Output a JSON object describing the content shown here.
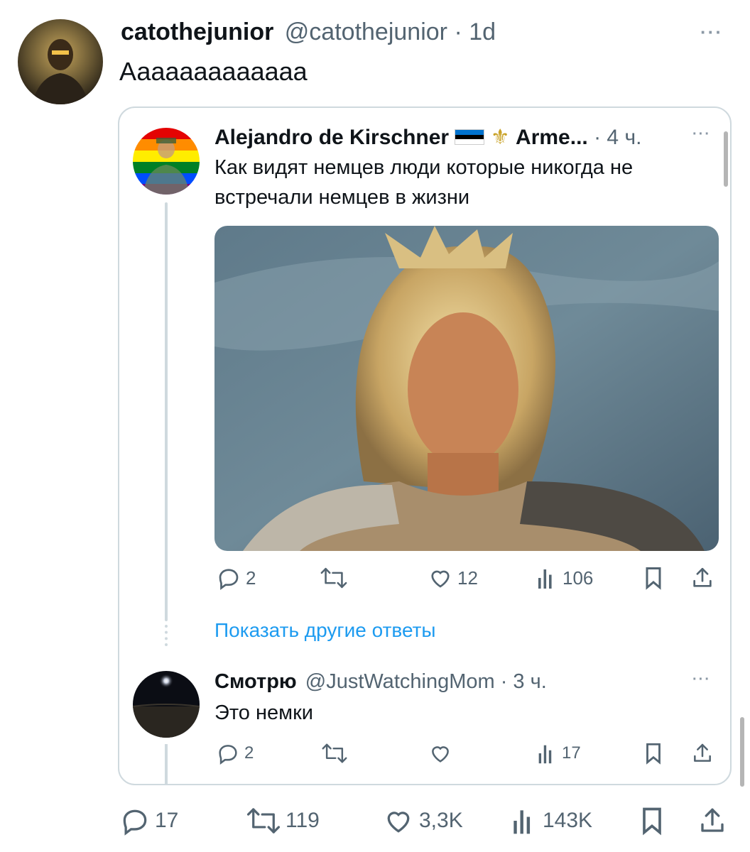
{
  "tweet": {
    "display_name": "catothejunior",
    "handle": "@catothejunior",
    "time": "· 1d",
    "text": "Ааааааааааааа",
    "menu_label": "···",
    "actions": {
      "replies": "17",
      "reposts": "119",
      "likes": "3,3K",
      "views": "143K"
    }
  },
  "embedded": {
    "post": {
      "display_name": "Alejandro de Kirschner",
      "suffix_name": "Arme...",
      "time": "· 4 ч.",
      "menu_label": "···",
      "text_line1": "Как видят немцев люди которые никогда не",
      "text_line2": "встречали немцев в жизни",
      "actions": {
        "replies": "2",
        "likes": "12",
        "views": "106"
      }
    },
    "show_more": "Показать другие ответы",
    "reply": {
      "display_name": "Смотрю",
      "handle": "@JustWatchingMom",
      "time": "· 3 ч.",
      "menu_label": "···",
      "text": "Это немки",
      "actions": {
        "replies": "2",
        "views": "17"
      }
    }
  },
  "colors": {
    "text": "#0f1419",
    "muted": "#536471",
    "link": "#1d9bf0",
    "border": "#cfd9de"
  }
}
